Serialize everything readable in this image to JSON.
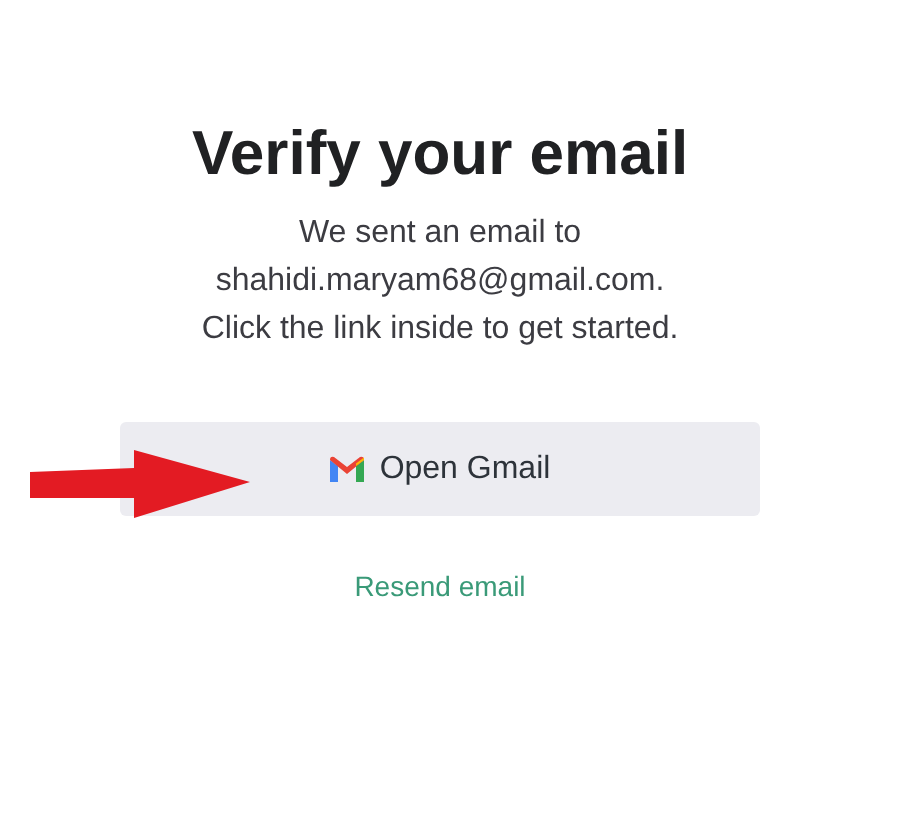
{
  "heading": "Verify your email",
  "message_lines": [
    "We sent an email to",
    "shahidi.maryam68@gmail.com.",
    "Click the link inside to get started."
  ],
  "open_button": {
    "label": "Open Gmail"
  },
  "resend_link": {
    "label": "Resend email"
  }
}
